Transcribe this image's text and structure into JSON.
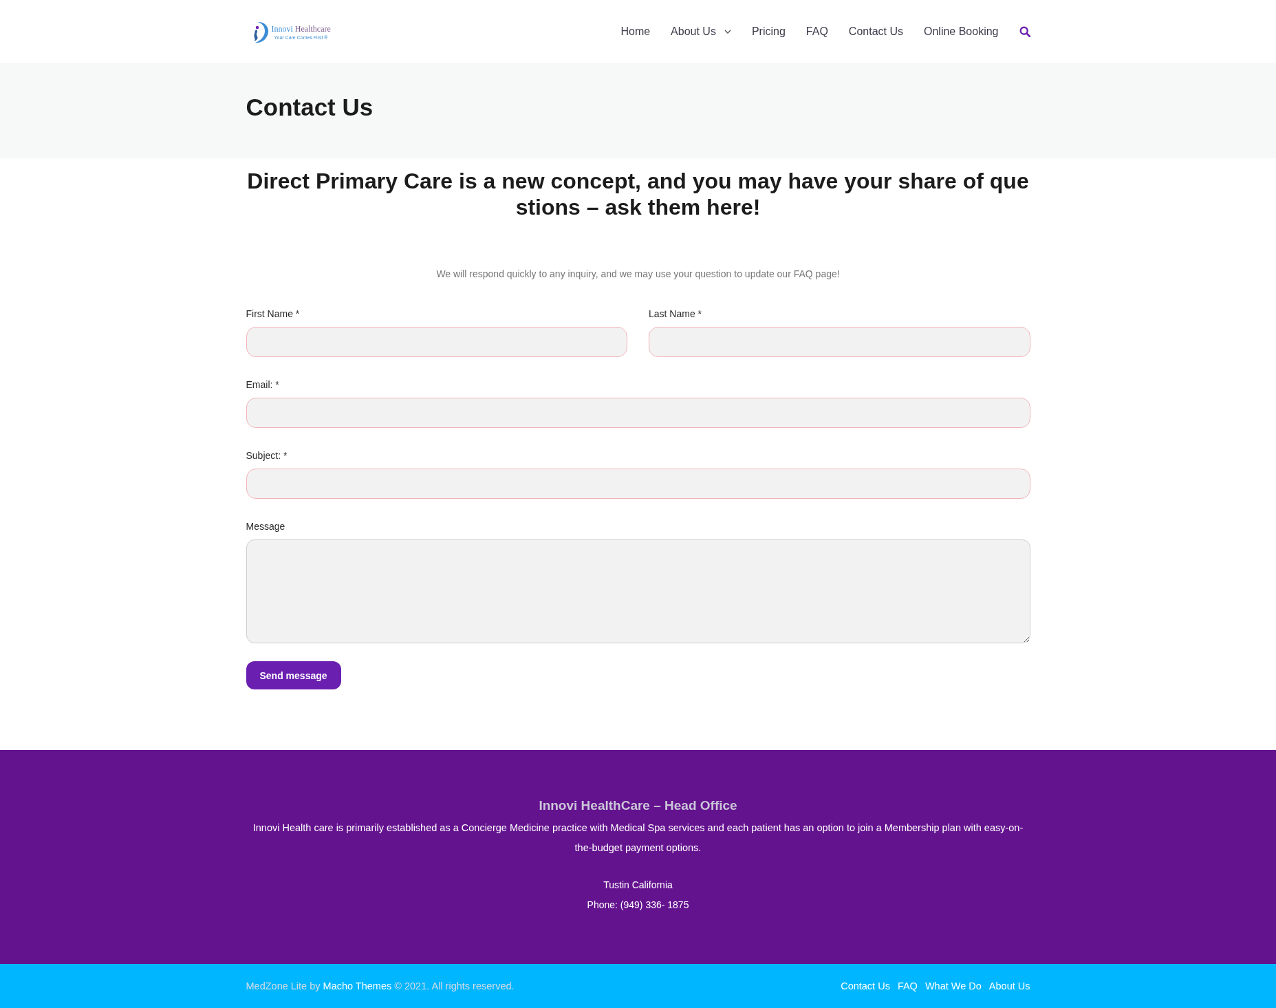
{
  "header": {
    "logo": {
      "words": [
        {
          "text": "Innovi",
          "color": "#3b8ed6"
        },
        {
          "text": "Healthcare",
          "color": "#7b5c8c"
        }
      ],
      "tagline": "Your Care Comes First ®"
    },
    "nav": [
      {
        "label": "Home",
        "kind": "link"
      },
      {
        "label": "About Us",
        "kind": "dropdown"
      },
      {
        "label": "Pricing",
        "kind": "link"
      },
      {
        "label": "FAQ",
        "kind": "link"
      },
      {
        "label": "Contact Us",
        "kind": "link"
      },
      {
        "label": "Online Booking",
        "kind": "link"
      }
    ]
  },
  "page_title": "Contact Us",
  "content": {
    "headline": "Direct Primary Care is a new concept, and you may have your share of questions – ask them here!",
    "intro": "We will respond quickly to any inquiry, and we may use your question to update our FAQ page!",
    "form": {
      "rows": [
        [
          {
            "label": "First Name *",
            "kind": "input"
          },
          {
            "label": "Last Name *",
            "kind": "input"
          }
        ],
        [
          {
            "label": "Email: *",
            "kind": "input"
          }
        ],
        [
          {
            "label": "Subject: *",
            "kind": "input"
          }
        ],
        [
          {
            "label": "Message",
            "kind": "textarea"
          }
        ]
      ],
      "submit": "Send message"
    }
  },
  "footer": {
    "heading": "Innovi HealthCare – Head Office",
    "description": "Innovi Health care is primarily established as a Concierge Medicine practice with Medical Spa services and each patient has an option to join a Membership plan with easy-on-the-budget payment options.",
    "address_lines": [
      "Tustin California",
      "Phone: (949) 336- 1875"
    ]
  },
  "bottom_bar": {
    "copyright": {
      "text_before_link": "MedZone Lite by",
      "link": "Macho Themes",
      "text_after_link": "© 2021. All rights reserved."
    },
    "links": [
      "Contact Us",
      "FAQ",
      "What We Do",
      "About Us"
    ]
  }
}
